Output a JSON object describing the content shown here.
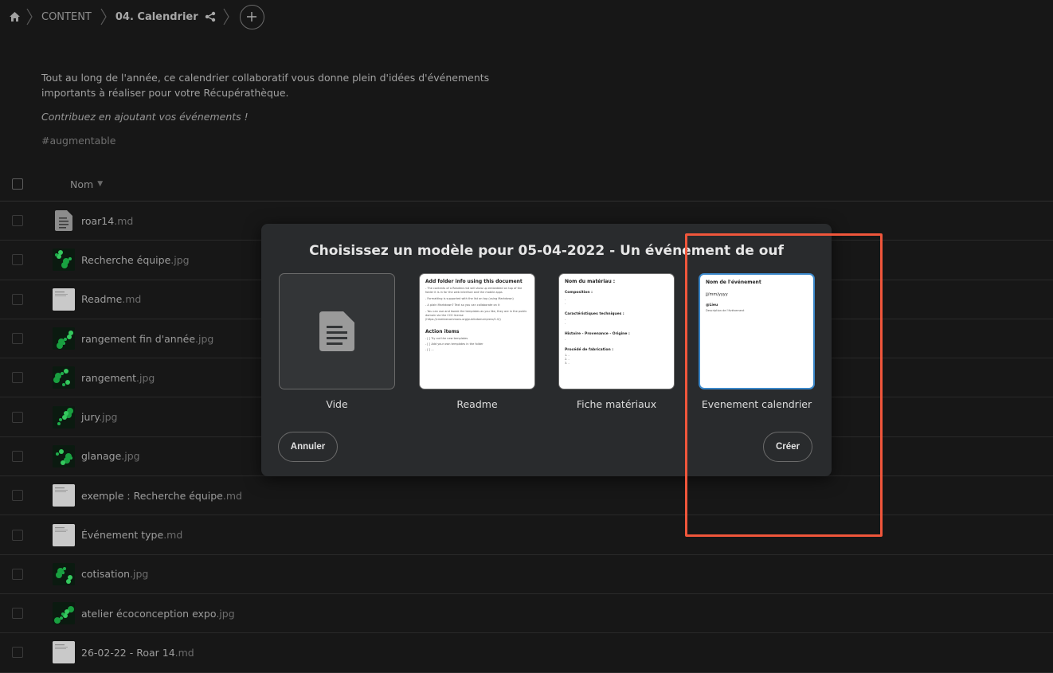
{
  "breadcrumb": {
    "root": "CONTENT",
    "current": "04. Calendrier"
  },
  "description": {
    "text": "Tout au long de l'année, ce calendrier collaboratif vous donne plein d'idées d'événements importants à réaliser pour votre Récupérathèque.",
    "italic": "Contribuez en ajoutant vos événements !",
    "tag": "#augmentable"
  },
  "list": {
    "header_name": "Nom",
    "files": [
      {
        "name": "roar14",
        "ext": ".md",
        "kind": "txt"
      },
      {
        "name": "Recherche équipe",
        "ext": ".jpg",
        "kind": "img"
      },
      {
        "name": "Readme",
        "ext": ".md",
        "kind": "doc"
      },
      {
        "name": "rangement fin d'année",
        "ext": ".jpg",
        "kind": "img"
      },
      {
        "name": "rangement",
        "ext": ".jpg",
        "kind": "img"
      },
      {
        "name": "jury",
        "ext": ".jpg",
        "kind": "img"
      },
      {
        "name": "glanage",
        "ext": ".jpg",
        "kind": "img"
      },
      {
        "name": "exemple : Recherche équipe",
        "ext": ".md",
        "kind": "doc"
      },
      {
        "name": "Événement type",
        "ext": ".md",
        "kind": "doc"
      },
      {
        "name": "cotisation",
        "ext": ".jpg",
        "kind": "img"
      },
      {
        "name": "atelier écoconception expo",
        "ext": ".jpg",
        "kind": "img"
      },
      {
        "name": "26-02-22 - Roar 14",
        "ext": ".md",
        "kind": "doc"
      }
    ]
  },
  "modal": {
    "title": "Choisissez un modèle pour 05-04-2022 - Un événement de ouf",
    "templates": [
      {
        "label": "Vide"
      },
      {
        "label": "Readme"
      },
      {
        "label": "Fiche matériaux"
      },
      {
        "label": "Evenement calendrier"
      }
    ],
    "readme_preview": {
      "h1": "Add folder info using this document",
      "l1": "- The contents of a Readme.md will show up embedded on top of the folder it is in for the web interface and the mobile apps",
      "l2": "- Formatting is supported with the list on top (using Markdown)",
      "l3": "- A plain Markdown? Text so you can collaborate on it",
      "l4": "- You can use and tweak the templates as you like, they are in the public domain via the CC0 license (https://creativecommons.org/publicdomain/zero/1.0/)",
      "h2": "Action items",
      "a1": "- [ ] Try out the new templates",
      "a2": "- [ ] Add your own templates in the folder",
      "a3": "- [ ] ..."
    },
    "fiche_preview": {
      "h1": "Nom du matériau :",
      "s1": "Composition :",
      "s2": "Caractéristiques techniques :",
      "s3": "Histoire - Provenance - Origine :",
      "s4": "Procédé de fabrication :",
      "d": "-",
      "n1": "1. -",
      "n2": "2. -",
      "n3": "3. -"
    },
    "event_preview": {
      "h1": "Nom de l'événement",
      "date": "jj/mm/yyyy",
      "place": "@Lieu",
      "desc": "Description de l'événement"
    },
    "cancel_label": "Annuler",
    "create_label": "Créer"
  },
  "colors": {
    "highlight": "#f0563b",
    "selected_border": "#3a87c9",
    "background": "#171717",
    "modal_bg": "#292b2d"
  }
}
